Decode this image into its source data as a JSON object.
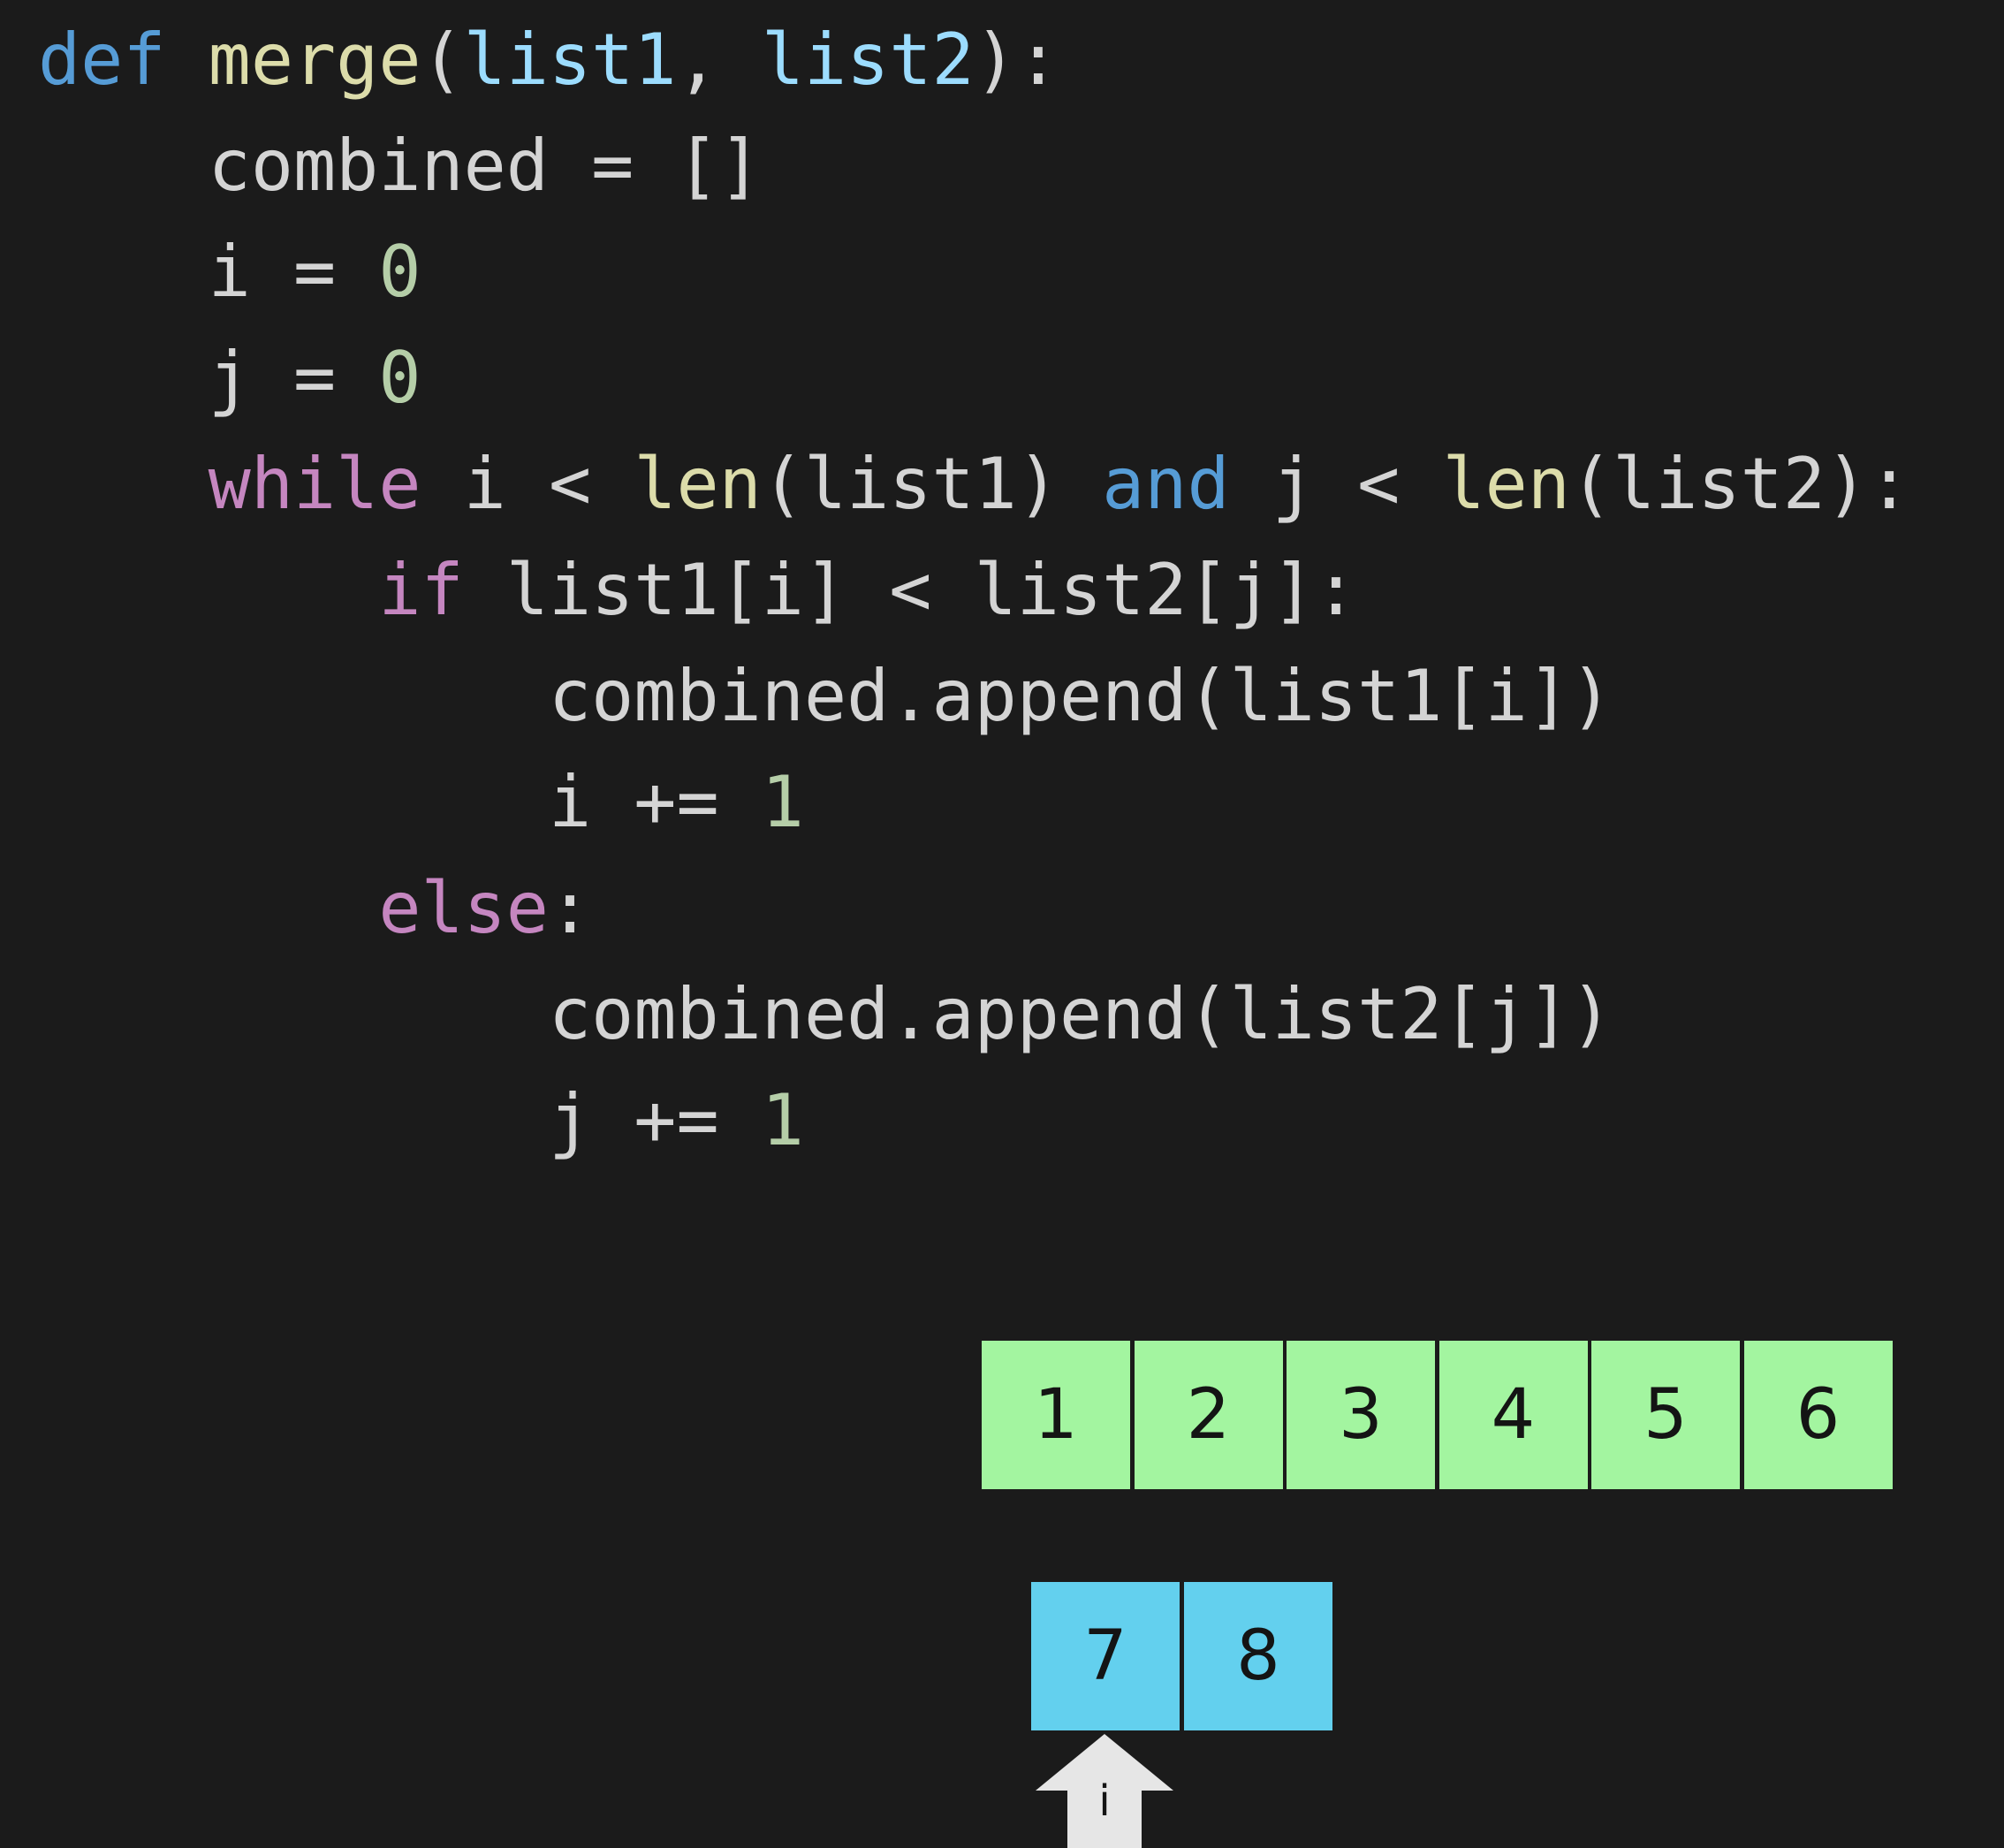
{
  "code_lines": [
    [
      {
        "t": "def",
        "c": "kw-def"
      },
      {
        "t": " "
      },
      {
        "t": "merge",
        "c": "fn"
      },
      {
        "t": "("
      },
      {
        "t": "list1",
        "c": "param"
      },
      {
        "t": ", "
      },
      {
        "t": "list2",
        "c": "param"
      },
      {
        "t": "):"
      }
    ],
    [
      {
        "t": "    combined = []"
      }
    ],
    [
      {
        "t": "    i = "
      },
      {
        "t": "0",
        "c": "num"
      }
    ],
    [
      {
        "t": "    j = "
      },
      {
        "t": "0",
        "c": "num"
      }
    ],
    [
      {
        "t": "    "
      },
      {
        "t": "while",
        "c": "kw-ctrl"
      },
      {
        "t": " i < "
      },
      {
        "t": "len",
        "c": "fn"
      },
      {
        "t": "(list1) "
      },
      {
        "t": "and",
        "c": "kw-and"
      },
      {
        "t": " j < "
      },
      {
        "t": "len",
        "c": "fn"
      },
      {
        "t": "(list2):"
      }
    ],
    [
      {
        "t": "        "
      },
      {
        "t": "if",
        "c": "kw-ctrl"
      },
      {
        "t": " list1[i] < list2[j]:"
      }
    ],
    [
      {
        "t": "            combined.append(list1[i])"
      }
    ],
    [
      {
        "t": "            i += "
      },
      {
        "t": "1",
        "c": "num"
      }
    ],
    [
      {
        "t": "        "
      },
      {
        "t": "else",
        "c": "kw-ctrl"
      },
      {
        "t": ":"
      }
    ],
    [
      {
        "t": "            combined.append(list2[j])"
      }
    ],
    [
      {
        "t": "            j += "
      },
      {
        "t": "1",
        "c": "num"
      }
    ]
  ],
  "combined_list": [
    "1",
    "2",
    "3",
    "4",
    "5",
    "6"
  ],
  "list2_remaining": [
    "7",
    "8"
  ],
  "pointer": {
    "label": "i"
  },
  "colors": {
    "background": "#1b1b1b",
    "combined_cell": "#a3f5a0",
    "list_cell": "#63d0ee",
    "pointer": "#e6e6e6"
  }
}
